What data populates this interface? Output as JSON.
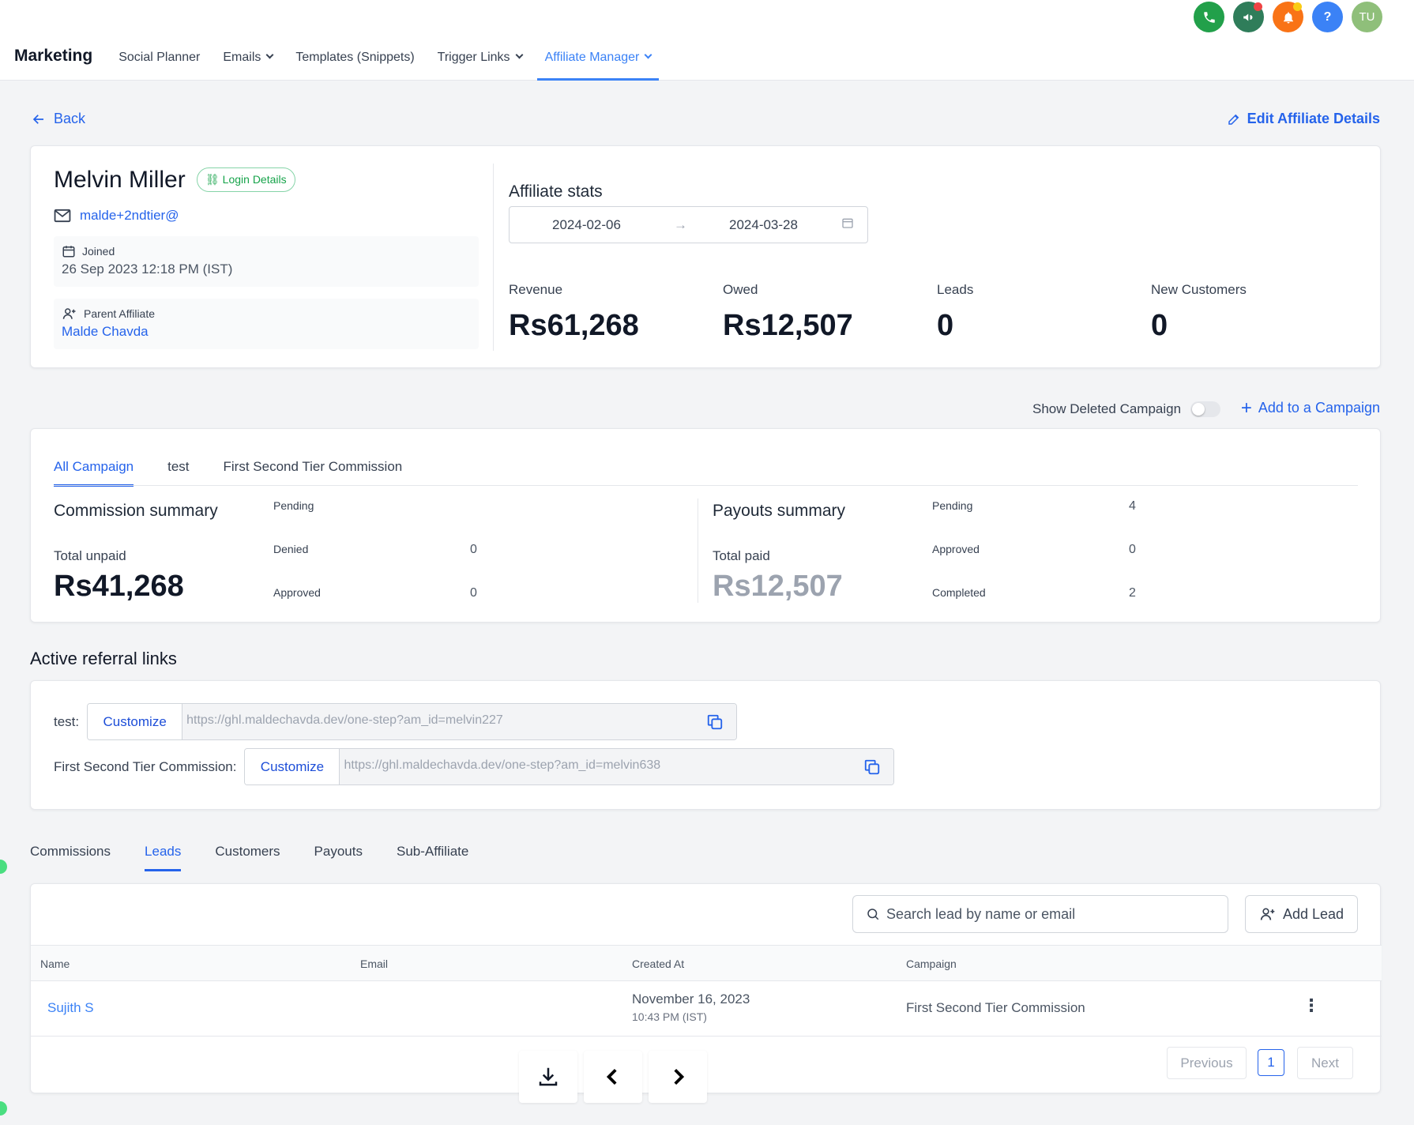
{
  "header": {
    "brand": "Marketing",
    "nav": [
      {
        "label": "Social Planner",
        "dropdown": false
      },
      {
        "label": "Emails",
        "dropdown": true
      },
      {
        "label": "Templates (Snippets)",
        "dropdown": false
      },
      {
        "label": "Trigger Links",
        "dropdown": true
      },
      {
        "label": "Affiliate Manager",
        "dropdown": true,
        "active": true
      }
    ],
    "icons": [
      {
        "name": "phone-icon",
        "color": "#22a04a"
      },
      {
        "name": "megaphone-icon",
        "color": "#2f7d5a"
      },
      {
        "name": "bell-icon",
        "color": "#f97316"
      },
      {
        "name": "help-icon",
        "color": "#3b82f6",
        "glyph": "?"
      },
      {
        "name": "avatar",
        "color": "#8fbf7a",
        "glyph": "TU"
      }
    ]
  },
  "back_label": "Back",
  "edit_label": "Edit Affiliate Details",
  "profile": {
    "name": "Melvin Miller",
    "login_badge": "Login Details",
    "email": "malde+2ndtier@",
    "joined_label": "Joined",
    "joined_value": "26 Sep 2023 12:18 PM (IST)",
    "parent_label": "Parent Affiliate",
    "parent_value": "Malde Chavda"
  },
  "stats": {
    "title": "Affiliate stats",
    "date_from": "2024-02-06",
    "date_to": "2024-03-28",
    "items": [
      {
        "label": "Revenue",
        "value": "Rs61,268"
      },
      {
        "label": "Owed",
        "value": "Rs12,507"
      },
      {
        "label": "Leads",
        "value": "0"
      },
      {
        "label": "New Customers",
        "value": "0"
      }
    ]
  },
  "campaign_controls": {
    "show_deleted": "Show Deleted Campaign",
    "add_to_campaign": "Add to a Campaign"
  },
  "campaign_tabs": [
    "All Campaign",
    "test",
    "First Second Tier Commission"
  ],
  "commission": {
    "title": "Commission summary",
    "total_label": "Total unpaid",
    "total_value": "Rs41,268",
    "rows": [
      {
        "label": "Pending",
        "value": ""
      },
      {
        "label": "Denied",
        "value": "0"
      },
      {
        "label": "Approved",
        "value": "0"
      }
    ]
  },
  "payouts": {
    "title": "Payouts summary",
    "total_label": "Total paid",
    "total_value": "Rs12,507",
    "rows": [
      {
        "label": "Pending",
        "value": "4"
      },
      {
        "label": "Approved",
        "value": "0"
      },
      {
        "label": "Completed",
        "value": "2"
      }
    ]
  },
  "referral": {
    "title": "Active referral links",
    "links": [
      {
        "label": "test:",
        "button": "Customize",
        "url": "https://ghl.maldechavda.dev/one-step?am_id=melvin227"
      },
      {
        "label": "First Second Tier Commission:",
        "button": "Customize",
        "url": "https://ghl.maldechavda.dev/one-step?am_id=melvin638"
      }
    ]
  },
  "bottom_tabs": [
    "Commissions",
    "Leads",
    "Customers",
    "Payouts",
    "Sub-Affiliate"
  ],
  "leads": {
    "search_placeholder": "Search lead by name or email",
    "add_lead": "Add Lead",
    "columns": [
      "Name",
      "Email",
      "Created At",
      "Campaign"
    ],
    "rows": [
      {
        "name": "Sujith S",
        "email": "",
        "created_date": "November 16, 2023",
        "created_time": "10:43 PM (IST)",
        "campaign": "First Second Tier Commission"
      }
    ],
    "pagination": {
      "previous": "Previous",
      "page": "1",
      "next": "Next"
    }
  }
}
